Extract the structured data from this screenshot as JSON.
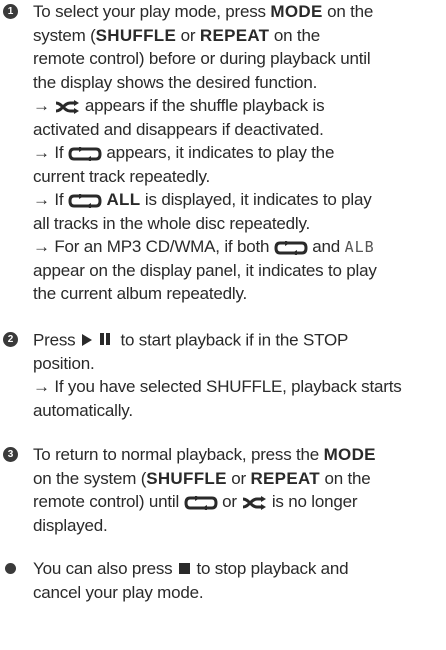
{
  "markers": {
    "step1": "1",
    "step2": "2",
    "step3": "3"
  },
  "step1": {
    "l1a": "To select your play mode, press ",
    "l1b": "MODE",
    "l1c": " on the",
    "l2a": "system (",
    "l2b": "SHUFFLE",
    "l2c": " or ",
    "l2d": "REPEAT",
    "l2e": " on the",
    "l3": "remote control) before or during playback until",
    "l4": "the display shows the desired function.",
    "l5a": "→ ",
    "l5b": " appears if the shuffle playback is",
    "l6": "activated and disappears if deactivated.",
    "l7a": "→ If ",
    "l7b": " appears, it indicates to play the",
    "l8": "current track repeatedly.",
    "l9a": "→ If ",
    "l9b": "ALL",
    "l9c": " is displayed, it indicates to play",
    "l10": "all tracks in the whole disc repeatedly.",
    "l11a": "→ For an MP3 CD/WMA, if both ",
    "l11b": " and ",
    "l11lcd": "ALB",
    "l12": "appear on the display panel, it indicates to play",
    "l13": "the current album repeatedly."
  },
  "step2": {
    "l1a": "Press ",
    "l1b": " to start playback if in the STOP",
    "l2": "position.",
    "l3": "→ If you have selected SHUFFLE, playback starts",
    "l4": "automatically."
  },
  "step3": {
    "l1a": "To return to normal playback, press the ",
    "l1b": "MODE",
    "l2a": "on the system (",
    "l2b": "SHUFFLE",
    "l2c": " or ",
    "l2d": "REPEAT",
    "l2e": " on the",
    "l3a": "remote control) until ",
    "l3b": " or ",
    "l3c": " is no longer",
    "l4": "displayed."
  },
  "note": {
    "l1a": "You can also press ",
    "l1b": " to stop playback and",
    "l2": "cancel your play mode."
  },
  "icons": {
    "shuffle": "shuffle-icon",
    "repeat": "repeat-icon",
    "play": "play-icon",
    "pause": "pause-icon",
    "stop": "stop-icon"
  }
}
